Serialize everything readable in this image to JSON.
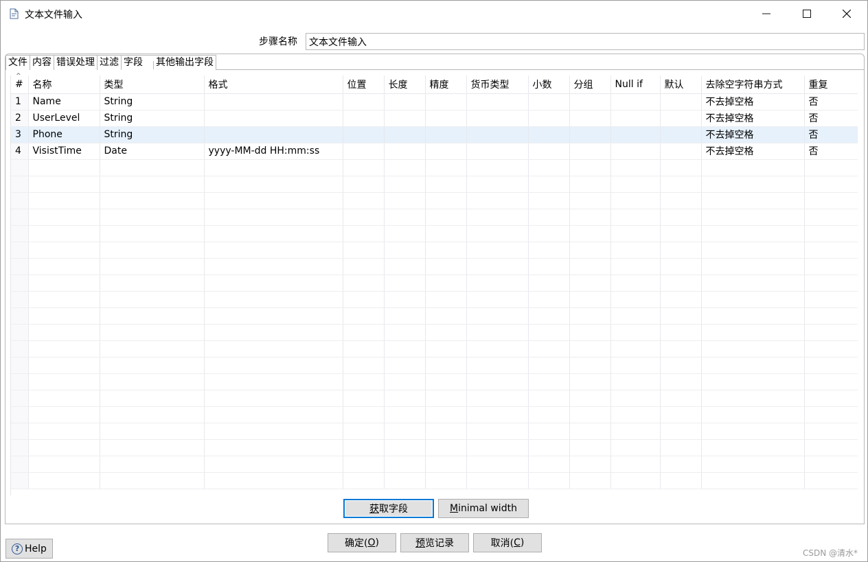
{
  "window": {
    "title": "文本文件输入",
    "minimize_icon": "minimize-icon",
    "maximize_icon": "maximize-icon",
    "close_icon": "close-icon"
  },
  "step": {
    "label": "步骤名称",
    "value": "文本文件输入"
  },
  "tabs": [
    {
      "label": "文件"
    },
    {
      "label": "内容"
    },
    {
      "label": "错误处理"
    },
    {
      "label": "过滤"
    },
    {
      "label": "字段",
      "active": true
    },
    {
      "label": "其他输出字段"
    }
  ],
  "grid": {
    "sort_indicator": "^",
    "headers": [
      "#",
      "名称",
      "类型",
      "格式",
      "位置",
      "长度",
      "精度",
      "货币类型",
      "小数",
      "分组",
      "Null if",
      "默认",
      "去除空字符串方式",
      "重复"
    ],
    "rows": [
      [
        "1",
        "Name",
        "String",
        "",
        "",
        "",
        "",
        "",
        "",
        "",
        "",
        "",
        "不去掉空格",
        "否"
      ],
      [
        "2",
        "UserLevel",
        "String",
        "",
        "",
        "",
        "",
        "",
        "",
        "",
        "",
        "",
        "不去掉空格",
        "否"
      ],
      [
        "3",
        "Phone",
        "String",
        "",
        "",
        "",
        "",
        "",
        "",
        "",
        "",
        "",
        "不去掉空格",
        "否"
      ],
      [
        "4",
        "VisistTime",
        "Date",
        "yyyy-MM-dd HH:mm:ss",
        "",
        "",
        "",
        "",
        "",
        "",
        "",
        "",
        "不去掉空格",
        "否"
      ]
    ],
    "selected_row": 3
  },
  "buttons": {
    "get_fields": {
      "mnemonic": "获",
      "rest": "取字段"
    },
    "min_width": {
      "mnemonic": "M",
      "rest": "inimal width"
    },
    "ok": {
      "prefix": "确定(",
      "mnemonic": "O",
      "suffix": ")"
    },
    "preview": {
      "mnemonic": "预",
      "rest": "览记录"
    },
    "cancel": {
      "prefix": "取消(",
      "mnemonic": "C",
      "suffix": ")"
    },
    "help": {
      "icon": "help-icon",
      "glyph": "?",
      "label": "Help"
    }
  },
  "watermark": "CSDN @清水*"
}
